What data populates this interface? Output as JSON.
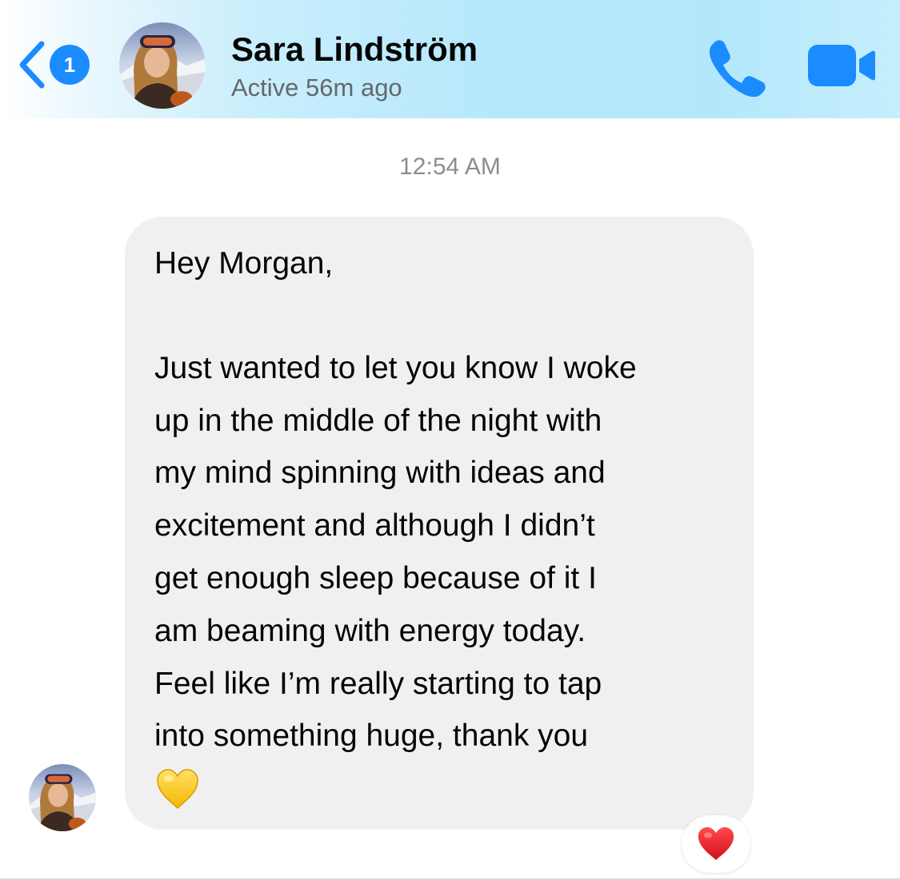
{
  "header": {
    "back_badge_count": "1",
    "contact_name": "Sara Lindström",
    "status": "Active 56m ago",
    "accent_color": "#1a8cff"
  },
  "thread": {
    "timestamp": "12:54 AM",
    "message": {
      "lines": [
        "Hey Morgan,",
        "Just wanted to let you know I woke",
        "up in the middle of the night with",
        "my mind spinning with ideas and",
        "excitement and although I didn’t",
        "get enough sleep because of it I",
        "am beaming with energy today.",
        "Feel like I’m really starting to tap",
        "into something huge, thank you"
      ],
      "emoji": "yellow-heart",
      "reaction": "red-heart"
    }
  },
  "icons": {
    "back": "chevron-left-icon",
    "call": "phone-icon",
    "video": "video-camera-icon"
  }
}
